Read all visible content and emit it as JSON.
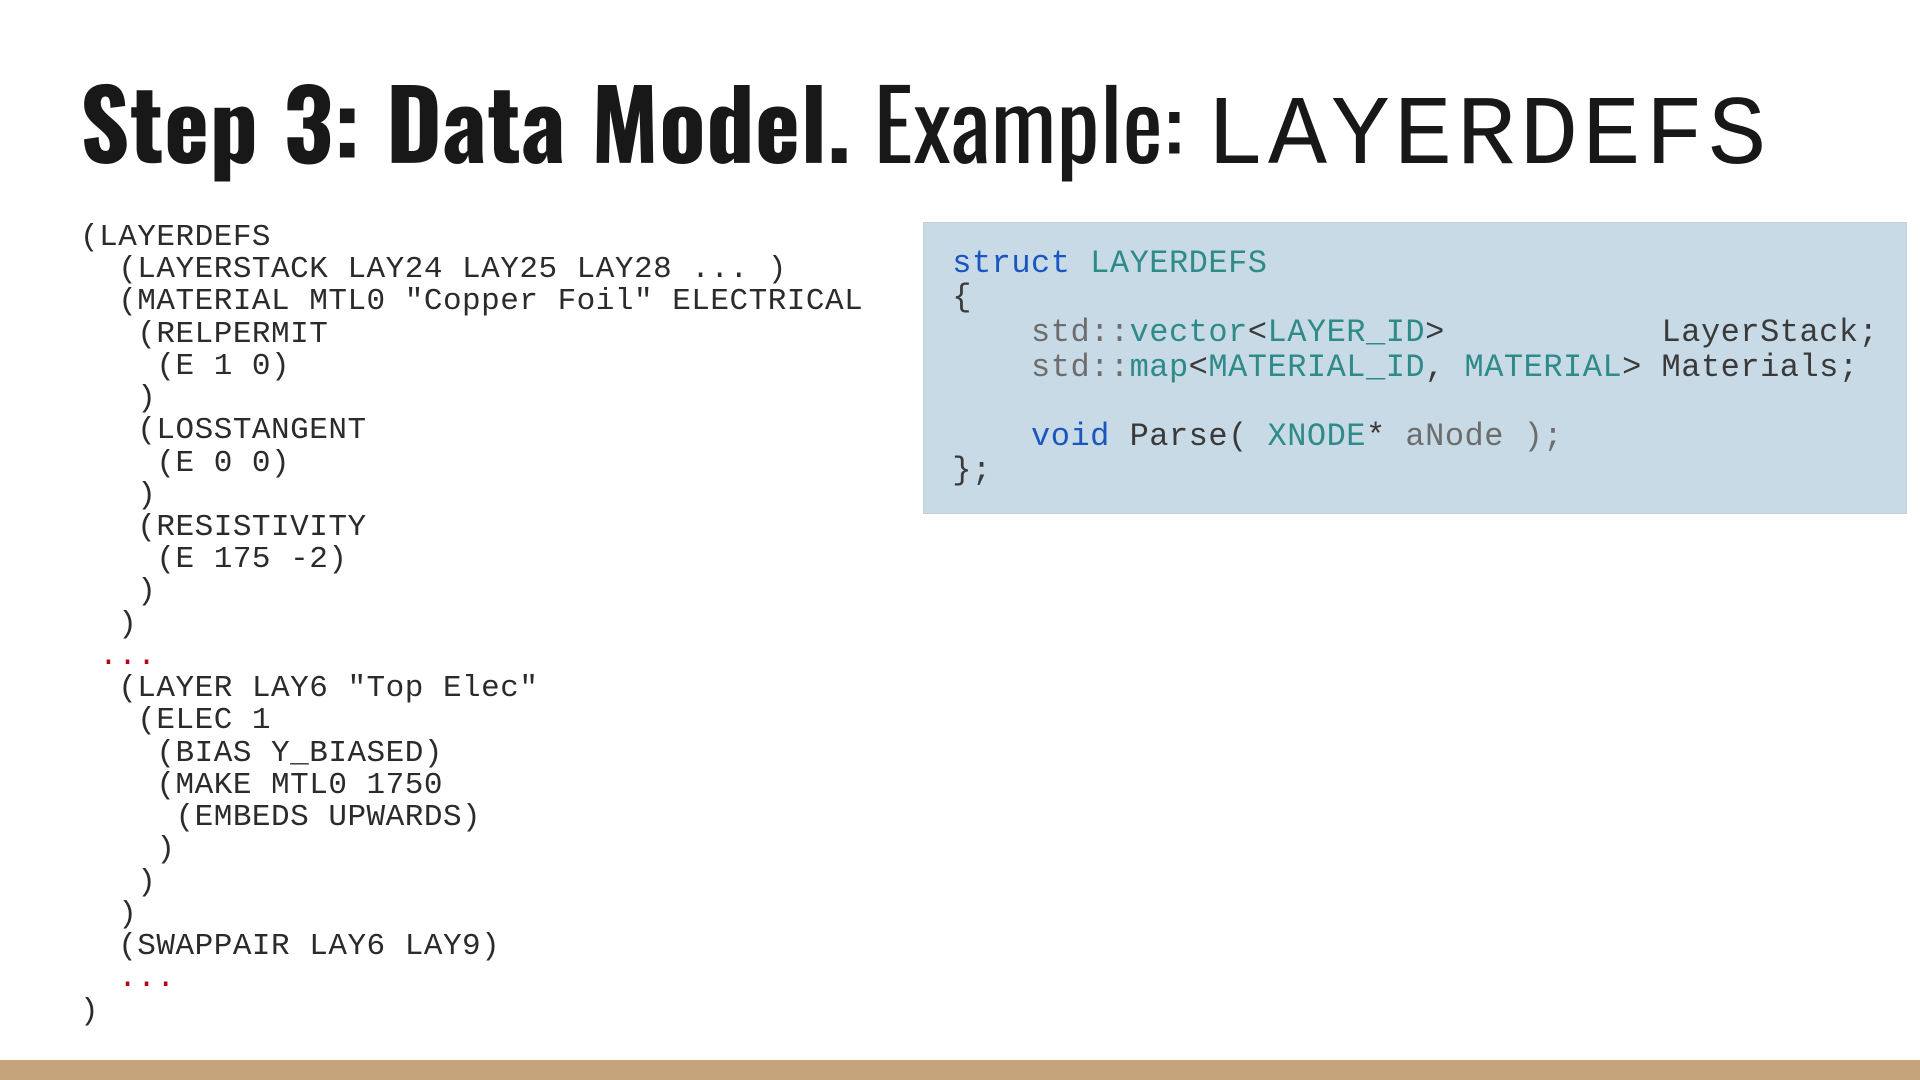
{
  "title": {
    "bold": "Step 3: Data Model.",
    "reg": " Example: ",
    "mono": "LAYERDEFS"
  },
  "sexpr": {
    "l01": "(LAYERDEFS",
    "l02": "  (LAYERSTACK LAY24 LAY25 LAY28 ... )",
    "l03": "  (MATERIAL MTL0 \"Copper Foil\" ELECTRICAL",
    "l04": "   (RELPERMIT",
    "l05": "    (E 1 0)",
    "l06": "   )",
    "l07": "   (LOSSTANGENT",
    "l08": "    (E 0 0)",
    "l09": "   )",
    "l10": "   (RESISTIVITY",
    "l11": "    (E 175 -2)",
    "l12": "   )",
    "l13": "  )",
    "l14": " ...",
    "l15": "  (LAYER LAY6 \"Top Elec\"",
    "l16": "   (ELEC 1",
    "l17": "    (BIAS Y_BIASED)",
    "l18": "    (MAKE MTL0 1750",
    "l19": "     (EMBEDS UPWARDS)",
    "l20": "    )",
    "l21": "   )",
    "l22": "  )",
    "l23": "  (SWAPPAIR LAY6 LAY9)",
    "l24": "  ...",
    "l25": ")"
  },
  "cpp": {
    "kw_struct": "struct",
    "name": "LAYERDEFS",
    "open_brace": "{",
    "ns1a": "    std::",
    "vector": "vector",
    "lt1": "<",
    "layer_id": "LAYER_ID",
    "gt1": ">",
    "pad1": "           ",
    "field1": "LayerStack;",
    "ns2a": "    std::",
    "map": "map",
    "lt2": "<",
    "material_id": "MATERIAL_ID",
    "comma": ", ",
    "material": "MATERIAL",
    "gt2": ">",
    "space2": " ",
    "field2": "Materials;",
    "blank": "",
    "parse_indent": "    ",
    "kw_void": "void",
    "parse_name": " Parse( ",
    "xnode": "XNODE",
    "star": "*",
    "anode": " aNode );",
    "close": "};"
  }
}
